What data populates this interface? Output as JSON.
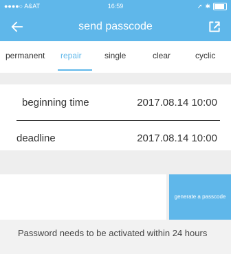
{
  "status": {
    "carrier": "●●●●○ A&AT",
    "time": "16:59"
  },
  "header": {
    "title": "send passcode",
    "back_icon": "arrow-left-icon",
    "share_icon": "share-icon",
    "color": "#5fb7ea"
  },
  "tabs": [
    {
      "label": "permanent"
    },
    {
      "label": "repair"
    },
    {
      "label": "single"
    },
    {
      "label": "clear"
    },
    {
      "label": "cyclic"
    }
  ],
  "active_tab": "repair",
  "fields": {
    "beginning": {
      "label": "beginning time",
      "value": "2017.08.14 10:00"
    },
    "deadline": {
      "label": "deadline",
      "value": "2017.08.14 10:00"
    }
  },
  "actions": {
    "generate_label": "generate a passcode"
  },
  "notice": "Password needs to be activated within 24 hours"
}
